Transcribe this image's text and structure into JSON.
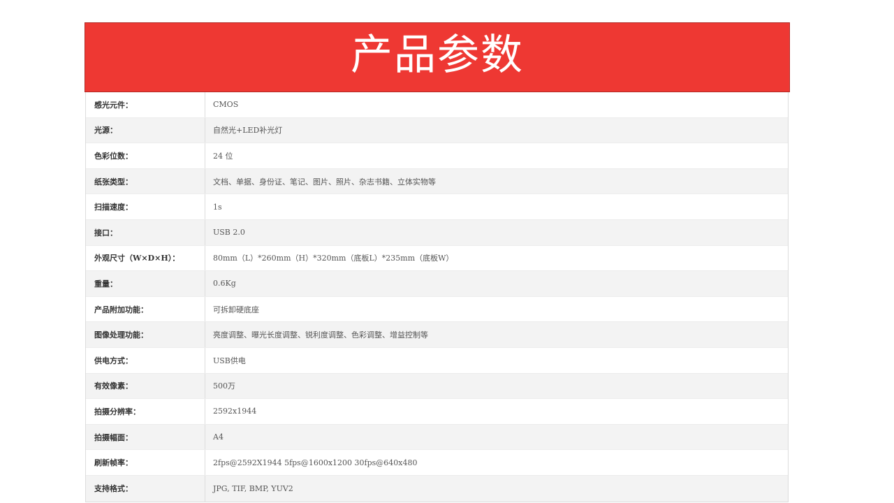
{
  "header": {
    "title": "产品参数",
    "background": "#ee3833"
  },
  "specs": [
    {
      "label": "感光元件：",
      "value": "CMOS"
    },
    {
      "label": "光源：",
      "value": "自然光+LED补光灯"
    },
    {
      "label": "色彩位数：",
      "value": "24 位"
    },
    {
      "label": "纸张类型：",
      "value": "文档、单据、身份证、笔记、图片、照片、杂志书籍、立体实物等"
    },
    {
      "label": "扫描速度：",
      "value": "1s"
    },
    {
      "label": "接口：",
      "value": "USB 2.0"
    },
    {
      "label": "外观尺寸（W×D×H）：",
      "value": "80mm（L）*260mm（H）*320mm（底板L）*235mm（底板W）"
    },
    {
      "label": "重量：",
      "value": "0.6Kg"
    },
    {
      "label": "产品附加功能：",
      "value": "可拆卸硬底座"
    },
    {
      "label": "图像处理功能：",
      "value": "亮度调整、曝光长度调整、锐利度调整、色彩调整、增益控制等"
    },
    {
      "label": "供电方式：",
      "value": "USB供电"
    },
    {
      "label": "有效像素：",
      "value": "500万"
    },
    {
      "label": "拍摄分辨率：",
      "value": "2592x1944"
    },
    {
      "label": "拍摄幅面：",
      "value": "A4"
    },
    {
      "label": "刷新帧率：",
      "value": "2fps@2592X1944 5fps@1600x1200 30fps@640x480"
    },
    {
      "label": "支持格式：",
      "value": "JPG, TIF, BMP, YUV2"
    }
  ]
}
